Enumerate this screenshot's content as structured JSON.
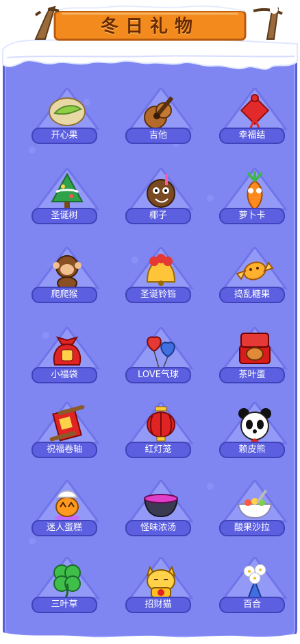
{
  "title": "冬日礼物",
  "items": [
    {
      "label": "开心果",
      "icon": "pistachio-icon"
    },
    {
      "label": "吉他",
      "icon": "guitar-icon"
    },
    {
      "label": "幸福结",
      "icon": "chinese-knot-icon"
    },
    {
      "label": "圣诞树",
      "icon": "christmas-tree-icon"
    },
    {
      "label": "椰子",
      "icon": "coconut-icon"
    },
    {
      "label": "萝卜卡",
      "icon": "carrot-card-icon"
    },
    {
      "label": "爬爬猴",
      "icon": "monkey-icon"
    },
    {
      "label": "圣诞铃铛",
      "icon": "christmas-bell-icon"
    },
    {
      "label": "捣乱糖果",
      "icon": "candy-icon"
    },
    {
      "label": "小福袋",
      "icon": "lucky-bag-icon"
    },
    {
      "label": "LOVE气球",
      "icon": "love-balloon-icon"
    },
    {
      "label": "茶叶蛋",
      "icon": "tea-egg-icon"
    },
    {
      "label": "祝福卷轴",
      "icon": "blessing-scroll-icon"
    },
    {
      "label": "红灯笼",
      "icon": "red-lantern-icon"
    },
    {
      "label": "赖皮熊",
      "icon": "panda-icon"
    },
    {
      "label": "迷人蛋糕",
      "icon": "cake-icon"
    },
    {
      "label": "怪味浓汤",
      "icon": "soup-icon"
    },
    {
      "label": "酸果沙拉",
      "icon": "salad-icon"
    },
    {
      "label": "三叶草",
      "icon": "clover-icon"
    },
    {
      "label": "招财猫",
      "icon": "lucky-cat-icon"
    },
    {
      "label": "百合",
      "icon": "lily-icon"
    }
  ],
  "colors": {
    "panel": "#7f86f2",
    "label_bg": "#5b5fe0",
    "banner": "#f28a1e",
    "title": "#6b2a00"
  }
}
